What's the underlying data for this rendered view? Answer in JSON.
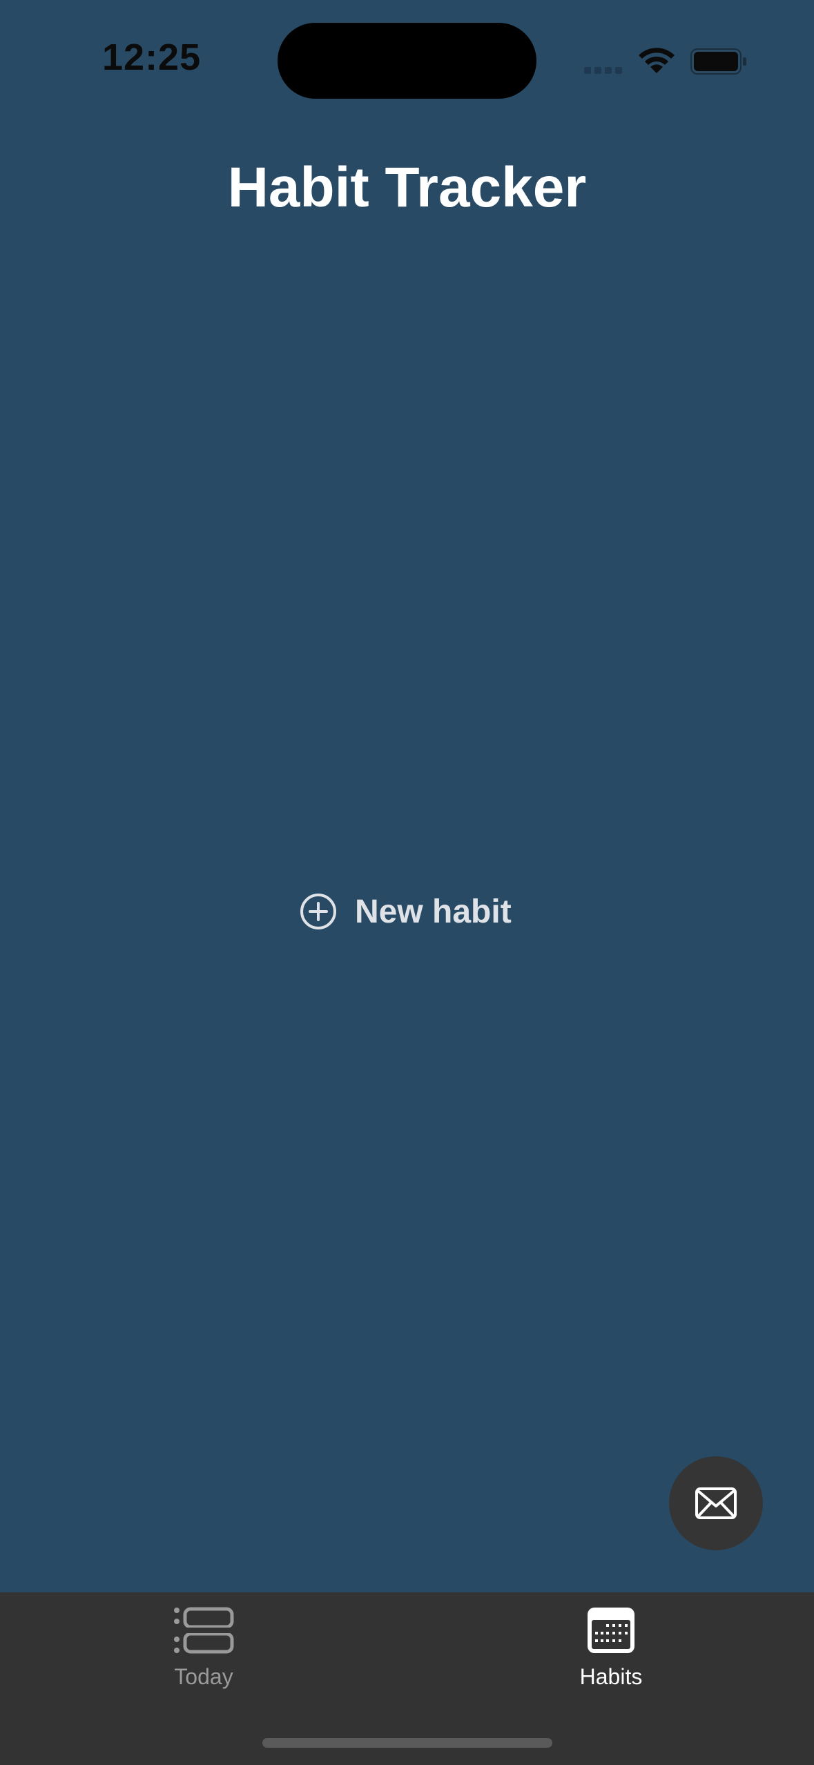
{
  "status_bar": {
    "time": "12:25"
  },
  "header": {
    "title": "Habit Tracker"
  },
  "main": {
    "new_habit_label": "New habit",
    "new_habit_icon": "plus-circle-icon"
  },
  "fab": {
    "icon": "envelope-icon"
  },
  "tab_bar": {
    "tabs": [
      {
        "label": "Today",
        "icon": "list-icon",
        "active": false
      },
      {
        "label": "Habits",
        "icon": "calendar-icon",
        "active": true
      }
    ]
  },
  "colors": {
    "background": "#294a64",
    "tab_bar": "#333333",
    "fab": "#353535",
    "active_tab": "#ffffff",
    "inactive_tab": "#9a9a9a"
  }
}
